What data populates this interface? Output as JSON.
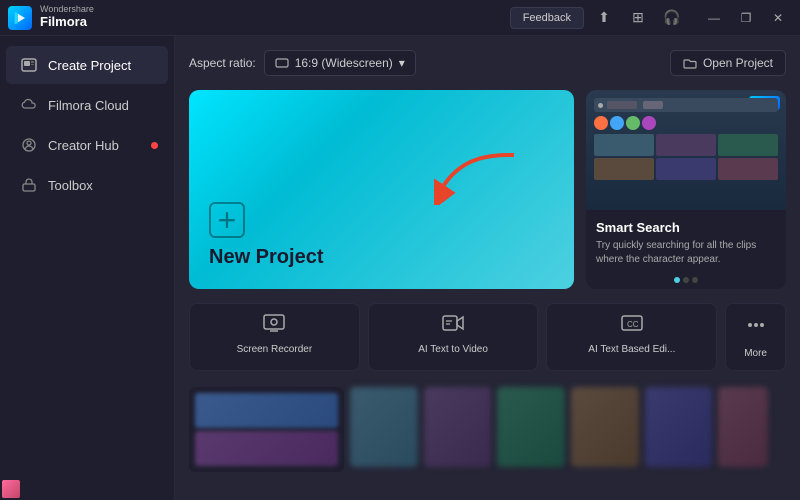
{
  "app": {
    "brand_top": "Wondershare",
    "brand_bottom": "Filmora",
    "logo_letter": "F"
  },
  "titlebar": {
    "feedback_label": "Feedback",
    "minimize_symbol": "—",
    "restore_symbol": "❐",
    "close_symbol": "✕"
  },
  "toolbar": {
    "aspect_ratio_label": "Aspect ratio:",
    "aspect_ratio_value": "16:9 (Widescreen)",
    "open_project_label": "Open Project"
  },
  "sidebar": {
    "items": [
      {
        "id": "create-project",
        "label": "Create Project",
        "active": true,
        "has_dot": false
      },
      {
        "id": "filmora-cloud",
        "label": "Filmora Cloud",
        "active": false,
        "has_dot": false
      },
      {
        "id": "creator-hub",
        "label": "Creator Hub",
        "active": false,
        "has_dot": true
      },
      {
        "id": "toolbox",
        "label": "Toolbox",
        "active": false,
        "has_dot": false
      }
    ]
  },
  "new_project": {
    "label": "New Project",
    "plus_symbol": "+"
  },
  "smart_search": {
    "badge": "New",
    "title": "Smart Search",
    "description": "Try quickly searching for all the clips where the character appear."
  },
  "quick_actions": [
    {
      "id": "screen-recorder",
      "label": "Screen Recorder"
    },
    {
      "id": "ai-text-to-video",
      "label": "AI Text to Video"
    },
    {
      "id": "ai-text-based-edit",
      "label": "AI Text Based Edi..."
    },
    {
      "id": "more",
      "label": "More"
    }
  ],
  "icons": {
    "grid": "⊞",
    "cloud": "☁",
    "headset": "🎧",
    "upload": "⬆",
    "folder": "📁",
    "monitor": "🖥",
    "film": "🎬",
    "caption": "CC",
    "dots": "•••",
    "chevron_down": "▾",
    "shield": "🛡"
  }
}
